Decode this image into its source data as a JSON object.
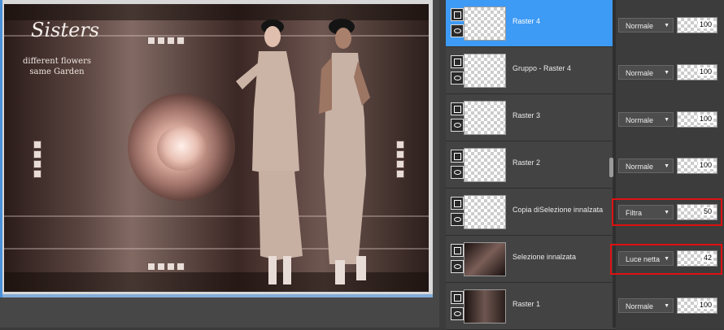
{
  "canvas": {
    "title_script": "Sisters",
    "subtitle_line1": "different flowers",
    "subtitle_line2": "same Garden"
  },
  "layers": [
    {
      "name": "Raster 4",
      "blend": "Normale",
      "opacity": "100",
      "selected": true
    },
    {
      "name": "Gruppo - Raster 4",
      "blend": "Normale",
      "opacity": "100",
      "selected": false
    },
    {
      "name": "Raster 3",
      "blend": "Normale",
      "opacity": "100",
      "selected": false
    },
    {
      "name": "Raster 2",
      "blend": "Normale",
      "opacity": "100",
      "selected": false
    },
    {
      "name": "Copia diSelezione innalzata",
      "blend": "Filtra",
      "opacity": "50",
      "selected": false
    },
    {
      "name": "Selezione innalzata",
      "blend": "Luce netta",
      "opacity": "42",
      "selected": false
    },
    {
      "name": "Raster 1",
      "blend": "Normale",
      "opacity": "100",
      "selected": false
    }
  ],
  "colors": {
    "selection": "#3d9af5",
    "highlight": "#dd1111"
  }
}
